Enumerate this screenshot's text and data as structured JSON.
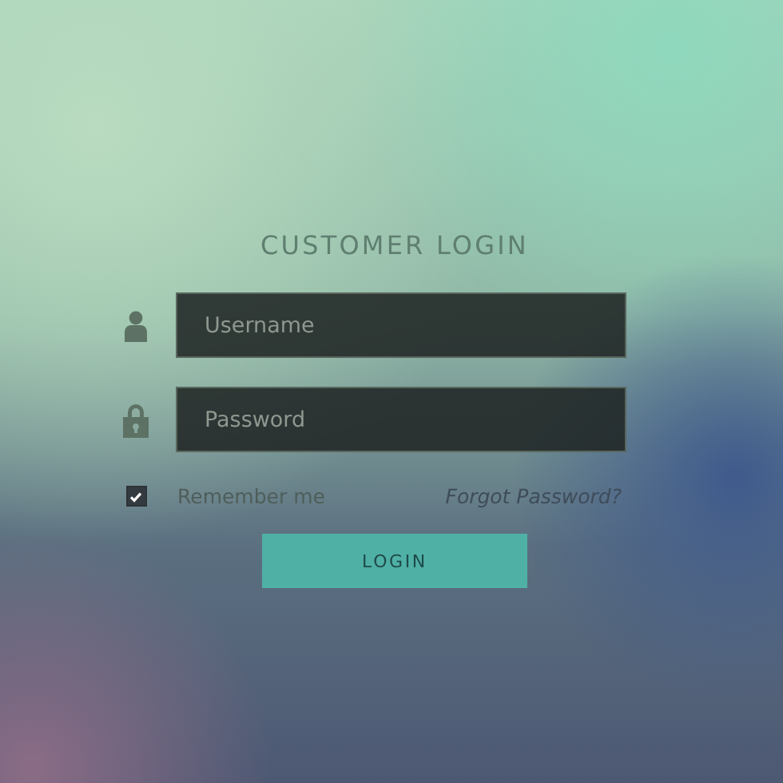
{
  "title": "CUSTOMER LOGIN",
  "fields": [
    {
      "kind": "user",
      "placeholder": "Username"
    },
    {
      "kind": "lock",
      "placeholder": "Password"
    }
  ],
  "remember": {
    "label": "Remember me",
    "checked": true
  },
  "forgot_link": "Forgot Password?",
  "login_button": "LOGIN"
}
